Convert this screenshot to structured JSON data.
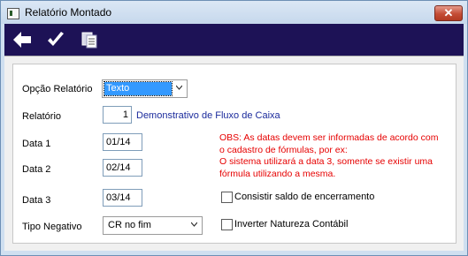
{
  "window": {
    "title": "Relatório Montado",
    "close_label": "✕"
  },
  "toolbar": {
    "icons": [
      "arrow-left-icon",
      "checkmark-icon",
      "copy-pages-icon"
    ]
  },
  "form": {
    "opcao_label": "Opção Relatório",
    "opcao_value": "Texto",
    "relatorio_label": "Relatório",
    "relatorio_value": "1",
    "relatorio_name": "Demonstrativo de Fluxo de Caixa",
    "data1_label": "Data 1",
    "data1_value": "01/14",
    "data2_label": "Data 2",
    "data2_value": "02/14",
    "data3_label": "Data 3",
    "data3_value": "03/14",
    "tipo_label": "Tipo Negativo",
    "tipo_value": "CR no fim",
    "obs_lines": [
      "OBS: As datas devem ser informadas de acordo com",
      "o cadastro de fórmulas, por ex:",
      "O sistema utilizará a data 3, somente se existir uma",
      "fórmula utilizando a mesma."
    ],
    "check_saldo_label": "Consistir saldo de encerramento",
    "check_saldo_checked": false,
    "check_natureza_label": "Inverter Natureza Contábil",
    "check_natureza_checked": false
  },
  "colors": {
    "toolbar_bg": "#1d1256",
    "note_red": "#e60000",
    "link_blue": "#1a2a9c"
  }
}
